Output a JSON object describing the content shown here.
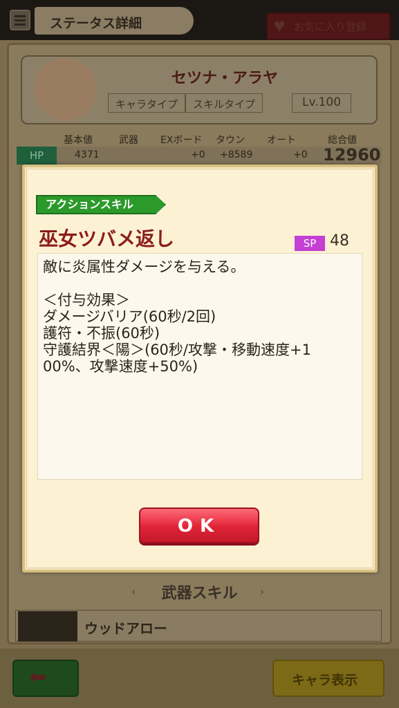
{
  "header": {
    "title": "ステータス詳細",
    "favorite_label": "お気に入り登録"
  },
  "character": {
    "name": "セツナ・アラヤ",
    "chara_type_label": "キャラタイプ",
    "skill_type_label": "スキルタイプ",
    "level": "Lv.100"
  },
  "stats": {
    "columns": [
      "基本値",
      "武器",
      "EXボード",
      "タウン",
      "オート",
      "総合値"
    ],
    "hp_label": "HP",
    "hp_values": [
      "4371",
      "",
      "+0",
      "+8589",
      "+0"
    ],
    "hp_total": "12960"
  },
  "weapon": {
    "section_title": "武器スキル",
    "name": "ウッドアロー"
  },
  "footer": {
    "chara_button": "キャラ表示"
  },
  "dialog": {
    "skill_category": "アクションスキル",
    "skill_name": "巫女ツバメ返し",
    "sp_label": "SP",
    "sp_value": "48",
    "description": [
      "敵に炎属性ダメージを与える。",
      "",
      "＜付与効果＞",
      "ダメージバリア(60秒/2回)",
      "護符・不振(60秒)",
      "守護結界＜陽＞(60秒/攻撃・移動速度+1",
      "00%、攻撃速度+50%)"
    ],
    "ok_label": "OK"
  },
  "colors": {
    "ok_button": "#e02336",
    "skill_label_bg": "#2c9a2b",
    "sp_badge": "#c43fd4",
    "skill_name": "#8a1d1d"
  }
}
